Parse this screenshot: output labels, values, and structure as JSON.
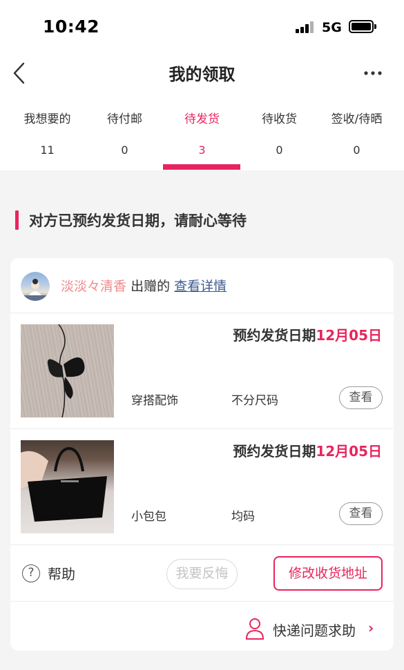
{
  "status_bar": {
    "time": "10:42",
    "network": "5G",
    "icons": [
      "signal-icon",
      "battery-icon"
    ]
  },
  "nav": {
    "title": "我的领取",
    "back_icon": "chevron-left-icon",
    "more_icon": "more-dots-icon"
  },
  "tabs": [
    {
      "label": "我想要的",
      "count": "11",
      "active": false
    },
    {
      "label": "待付邮",
      "count": "0",
      "active": false
    },
    {
      "label": "待发货",
      "count": "3",
      "active": true
    },
    {
      "label": "待收货",
      "count": "0",
      "active": false
    },
    {
      "label": "签收/待晒",
      "count": "0",
      "active": false
    }
  ],
  "notice": "对方已预约发货日期，请耐心等待",
  "giver": {
    "name": "淡淡々清香",
    "verb": "出赠的",
    "link": "查看详情"
  },
  "items": [
    {
      "date_label": "预约发货日期",
      "date": "12月05日",
      "category": "穿搭配饰",
      "size": "不分尺码",
      "view_label": "查看"
    },
    {
      "date_label": "预约发货日期",
      "date": "12月05日",
      "category": "小包包",
      "size": "均码",
      "view_label": "查看"
    }
  ],
  "actions": {
    "help_label": "帮助",
    "regret_label": "我要反悔",
    "address_label": "修改收货地址"
  },
  "courier_help": "快递问题求助",
  "colors": {
    "accent": "#e8245e",
    "giver_name": "#f08a8a",
    "link": "#3c5a8f",
    "background": "#f4f4f4"
  }
}
